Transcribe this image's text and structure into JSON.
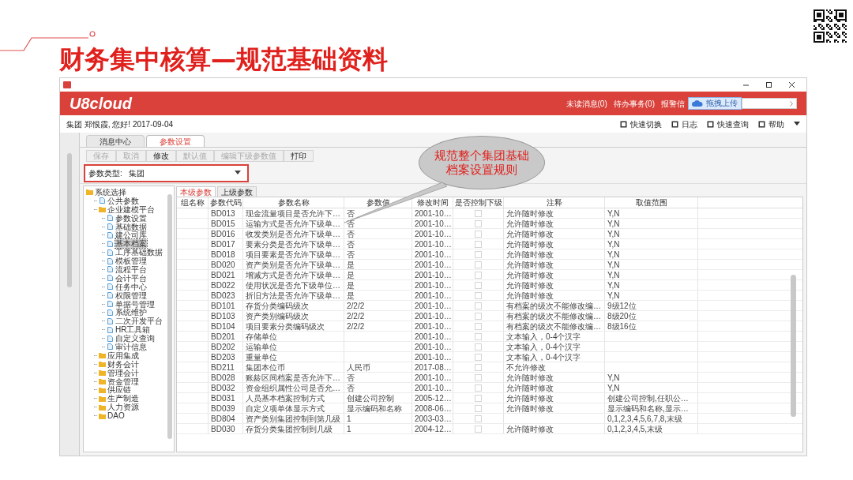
{
  "slide_title": "财务集中核算—规范基础资料",
  "window": {
    "brand": "U8cloud",
    "header_links": [
      "未读消息(0)",
      "待办事务(0)",
      "报警信"
    ],
    "upload_popup": "拖拽上传",
    "greeting": "集团 郑恨霞, 您好! 2017-09-04",
    "quick_actions": [
      "快速切换",
      "日志",
      "快速查询",
      "帮助"
    ]
  },
  "tabs": [
    {
      "label": "消息中心",
      "selected": false
    },
    {
      "label": "参数设置",
      "selected": true
    }
  ],
  "toolbar": [
    {
      "label": "保存",
      "disabled": true
    },
    {
      "label": "取消",
      "disabled": true
    },
    {
      "label": "修改",
      "disabled": false
    },
    {
      "label": "默认值",
      "disabled": true
    },
    {
      "label": "编辑下级参数值",
      "disabled": true
    },
    {
      "label": "打印",
      "disabled": false
    }
  ],
  "param_type": {
    "label": "参数类型:",
    "value": "集团"
  },
  "callout": [
    "规范整个集团基础",
    "档案设置规则"
  ],
  "tree": [
    {
      "label": "系统选择",
      "kind": "folder",
      "selected": false,
      "children": [
        {
          "label": "公共参数",
          "kind": "doc",
          "selected": false
        },
        {
          "label": "企业建模平台",
          "kind": "folder",
          "selected": false,
          "children": [
            {
              "label": "参数设置",
              "kind": "doc",
              "selected": false
            },
            {
              "label": "基础数据",
              "kind": "doc",
              "selected": false
            },
            {
              "label": "建公司库",
              "kind": "doc",
              "selected": false
            },
            {
              "label": "基本档案",
              "kind": "doc",
              "selected": true
            },
            {
              "label": "工序基础数据",
              "kind": "doc",
              "selected": false
            },
            {
              "label": "模板管理",
              "kind": "doc",
              "selected": false
            },
            {
              "label": "流程平台",
              "kind": "doc",
              "selected": false
            },
            {
              "label": "会计平台",
              "kind": "doc",
              "selected": false
            },
            {
              "label": "任务中心",
              "kind": "doc",
              "selected": false
            },
            {
              "label": "权限管理",
              "kind": "doc",
              "selected": false
            },
            {
              "label": "单据号管理",
              "kind": "doc",
              "selected": false
            },
            {
              "label": "系统维护",
              "kind": "doc",
              "selected": false
            },
            {
              "label": "二次开发平台",
              "kind": "doc",
              "selected": false
            },
            {
              "label": "HR工具箱",
              "kind": "doc",
              "selected": false
            },
            {
              "label": "自定义查询",
              "kind": "doc",
              "selected": false
            },
            {
              "label": "审计信息",
              "kind": "doc",
              "selected": false
            }
          ]
        },
        {
          "label": "应用集成",
          "kind": "folder",
          "selected": false
        },
        {
          "label": "财务会计",
          "kind": "folder",
          "selected": false
        },
        {
          "label": "管理会计",
          "kind": "folder",
          "selected": false
        },
        {
          "label": "资金管理",
          "kind": "folder",
          "selected": false
        },
        {
          "label": "供应链",
          "kind": "folder",
          "selected": false
        },
        {
          "label": "生产制造",
          "kind": "folder",
          "selected": false
        },
        {
          "label": "人力资源",
          "kind": "folder",
          "selected": false
        },
        {
          "label": "DAO",
          "kind": "folder",
          "selected": false
        }
      ]
    }
  ],
  "table_tabs": [
    {
      "label": "本级参数",
      "selected": true
    },
    {
      "label": "上级参数",
      "selected": false
    }
  ],
  "table": {
    "columns": [
      "组名称",
      "参数代码",
      "参数名称",
      "参数值",
      "修改时间",
      "是否控制下级",
      "注释",
      "取值范围"
    ],
    "rows": [
      {
        "code": "BD013",
        "name": "现金流量项目是否允许下…",
        "value": "否",
        "time": "2001-10…",
        "controlled": false,
        "note": "允许随时修改",
        "range": "Y,N"
      },
      {
        "code": "BD015",
        "name": "运输方式是否允许下级单…",
        "value": "否",
        "time": "2001-10…",
        "controlled": false,
        "note": "允许随时修改",
        "range": "Y,N"
      },
      {
        "code": "BD016",
        "name": "收发类别是否允许下级单…",
        "value": "否",
        "time": "2001-10…",
        "controlled": false,
        "note": "允许随时修改",
        "range": "Y,N"
      },
      {
        "code": "BD017",
        "name": "要素分类是否允许下级单…",
        "value": "否",
        "time": "2001-10…",
        "controlled": false,
        "note": "允许随时修改",
        "range": "Y,N"
      },
      {
        "code": "BD018",
        "name": "项目要素是否允许下级单…",
        "value": "否",
        "time": "2001-10…",
        "controlled": false,
        "note": "允许随时修改",
        "range": "Y,N"
      },
      {
        "code": "BD020",
        "name": "资产类别是否允许下级单…",
        "value": "是",
        "time": "2001-10…",
        "controlled": false,
        "note": "允许随时修改",
        "range": "Y,N"
      },
      {
        "code": "BD021",
        "name": "增减方式是否允许下级单…",
        "value": "是",
        "time": "2001-10…",
        "controlled": false,
        "note": "允许随时修改",
        "range": "Y,N"
      },
      {
        "code": "BD022",
        "name": "使用状况是否允下级单位…",
        "value": "是",
        "time": "2001-10…",
        "controlled": false,
        "note": "允许随时修改",
        "range": "Y,N"
      },
      {
        "code": "BD023",
        "name": "折旧方法是否允许下级单…",
        "value": "是",
        "time": "2001-10…",
        "controlled": false,
        "note": "允许随时修改",
        "range": "Y,N"
      },
      {
        "code": "BD101",
        "name": "存货分类编码级次",
        "value": "2/2/2",
        "time": "2001-10…",
        "controlled": false,
        "note": "有档案的级次不能修改编…",
        "range": "9级12位"
      },
      {
        "code": "BD103",
        "name": "资产类别编码级次",
        "value": "2/2/2",
        "time": "2001-10…",
        "controlled": false,
        "note": "有档案的级次不能修改编…",
        "range": "8级20位"
      },
      {
        "code": "BD104",
        "name": "项目要素分类编码级次",
        "value": "2/2/2",
        "time": "2001-10…",
        "controlled": false,
        "note": "有档案的级次不能修改编…",
        "range": "8级16位"
      },
      {
        "code": "BD201",
        "name": "存储单位",
        "time": "2001-10…",
        "controlled": false,
        "note": "文本输入，0-4个汉字"
      },
      {
        "code": "BD202",
        "name": "运输单位",
        "time": "2001-10…",
        "controlled": false,
        "note": "文本输入，0-4个汉字"
      },
      {
        "code": "BD203",
        "name": "重量单位",
        "time": "2001-10…",
        "controlled": false,
        "note": "文本输入，0-4个汉字"
      },
      {
        "code": "BD211",
        "name": "集团本位币",
        "value": "人民币",
        "time": "2017-08…",
        "controlled": false,
        "note": "不允许修改"
      },
      {
        "code": "BD028",
        "name": "账龄区间档案是否允许下…",
        "value": "否",
        "time": "2001-10…",
        "controlled": false,
        "note": "允许随时修改",
        "range": "Y,N"
      },
      {
        "code": "BD032",
        "name": "资金组织属性公司是否允…",
        "value": "否",
        "time": "2001-10…",
        "controlled": false,
        "note": "允许随时修改",
        "range": "Y,N"
      },
      {
        "code": "BD031",
        "name": "人员基本档案控制方式",
        "value": "创建公司控制",
        "time": "2005-12…",
        "controlled": false,
        "note": "允许随时修改",
        "range": "创建公司控制,任职公…"
      },
      {
        "code": "BD039",
        "name": "自定义项单体显示方式",
        "value": "显示编码和名称",
        "time": "2008-06…",
        "controlled": false,
        "note": "允许随时修改",
        "range": "显示编码和名称,显示…"
      },
      {
        "code": "BD804",
        "name": "资产类别集团控制到第几级",
        "value": "1",
        "time": "2003-03…",
        "controlled": false,
        "range": "0,1,2,3,4,5,6,7,8,末级"
      },
      {
        "code": "BD030",
        "name": "存货分类集团控制到几级",
        "value": "1",
        "time": "2004-12…",
        "controlled": false,
        "note": "允许随时修改",
        "range": "0,1,2,3,4,5,末级"
      }
    ]
  }
}
